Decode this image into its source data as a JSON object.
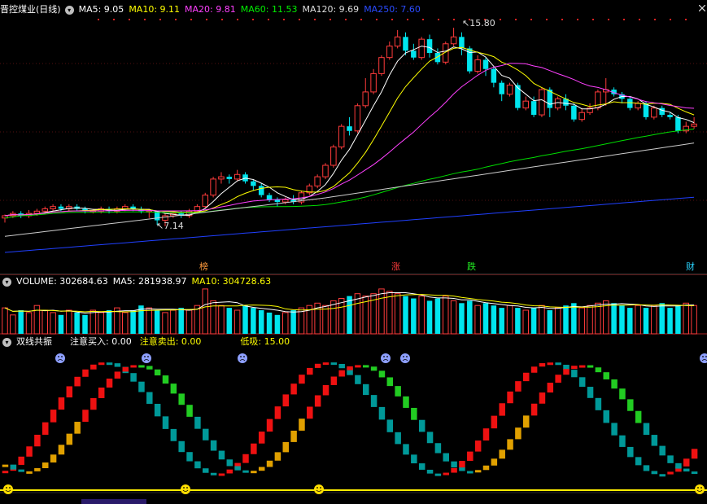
{
  "main_header": {
    "title": "晋控煤业(日线)",
    "ma5": "MA5: 9.05",
    "ma10": "MA10: 9.11",
    "ma20": "MA20: 9.81",
    "ma60": "MA60: 11.53",
    "ma120": "MA120: 9.69",
    "ma250": "MA250: 7.60"
  },
  "volume_header": {
    "volume": "VOLUME: 302684.63",
    "ma5": "MA5: 281938.97",
    "ma10": "MA10: 304728.63"
  },
  "indicator_header": {
    "name": "双线共振",
    "buy": "注意买入: 0.00",
    "sell": "注意卖出: 0.00",
    "low": "低吸: 15.00"
  },
  "annotations": {
    "high": "15.80",
    "low": "7.14"
  },
  "events": [
    "榜",
    "涨",
    "跌",
    "财"
  ],
  "colors": {
    "up": "#ff3b3b",
    "down": "#00e5ee",
    "ma5": "#ffffff",
    "ma10": "#ffff00",
    "ma20": "#ff40ff",
    "ma60": "#00dd00",
    "ma120": "#cccccc",
    "ma250": "#2040ff"
  },
  "chart_data": {
    "type": "candlestick",
    "price_range": [
      6.0,
      16.3
    ],
    "candles": [
      [
        7.5,
        7.6,
        7.3,
        7.65
      ],
      [
        7.6,
        7.7,
        7.5,
        7.8
      ],
      [
        7.7,
        7.6,
        7.5,
        7.8
      ],
      [
        7.6,
        7.7,
        7.5,
        7.85
      ],
      [
        7.7,
        7.8,
        7.6,
        7.9
      ],
      [
        7.8,
        7.9,
        7.7,
        8.0
      ],
      [
        7.9,
        8.0,
        7.8,
        8.1
      ],
      [
        8.0,
        7.9,
        7.8,
        8.1
      ],
      [
        7.9,
        8.0,
        7.8,
        8.1
      ],
      [
        8.0,
        7.9,
        7.8,
        8.1
      ],
      [
        7.9,
        7.8,
        7.7,
        8.0
      ],
      [
        7.8,
        7.8,
        7.7,
        7.9
      ],
      [
        7.8,
        7.9,
        7.7,
        8.0
      ],
      [
        7.9,
        7.8,
        7.7,
        8.0
      ],
      [
        7.8,
        7.9,
        7.7,
        8.0
      ],
      [
        7.9,
        8.0,
        7.8,
        8.1
      ],
      [
        8.0,
        7.9,
        7.8,
        8.1
      ],
      [
        7.9,
        7.8,
        7.7,
        8.0
      ],
      [
        7.8,
        7.8,
        7.5,
        7.9
      ],
      [
        7.8,
        7.4,
        7.2,
        7.8
      ],
      [
        7.4,
        7.6,
        7.14,
        7.7
      ],
      [
        7.6,
        7.7,
        7.5,
        7.8
      ],
      [
        7.7,
        7.6,
        7.5,
        7.8
      ],
      [
        7.6,
        7.8,
        7.5,
        7.9
      ],
      [
        7.8,
        8.0,
        7.7,
        8.1
      ],
      [
        8.0,
        8.5,
        7.9,
        8.6
      ],
      [
        8.5,
        9.2,
        8.4,
        9.3
      ],
      [
        9.2,
        9.3,
        9.0,
        9.5
      ],
      [
        9.3,
        9.2,
        9.0,
        9.4
      ],
      [
        9.2,
        9.4,
        9.1,
        9.6
      ],
      [
        9.4,
        9.1,
        9.0,
        9.5
      ],
      [
        9.1,
        8.9,
        8.7,
        9.2
      ],
      [
        8.9,
        8.5,
        8.4,
        9.0
      ],
      [
        8.5,
        8.3,
        8.2,
        8.6
      ],
      [
        8.3,
        8.2,
        8.0,
        8.4
      ],
      [
        8.2,
        8.3,
        8.1,
        8.4
      ],
      [
        8.3,
        8.2,
        8.1,
        8.5
      ],
      [
        8.2,
        8.6,
        8.1,
        8.7
      ],
      [
        8.6,
        8.9,
        8.5,
        9.0
      ],
      [
        8.9,
        9.3,
        8.8,
        9.4
      ],
      [
        9.3,
        9.8,
        9.2,
        9.9
      ],
      [
        9.8,
        10.6,
        9.7,
        10.7
      ],
      [
        10.6,
        11.5,
        10.5,
        11.6
      ],
      [
        11.5,
        11.3,
        11.1,
        11.9
      ],
      [
        11.3,
        12.4,
        11.2,
        12.5
      ],
      [
        12.4,
        13.0,
        12.3,
        13.6
      ],
      [
        13.0,
        13.8,
        12.9,
        14.0
      ],
      [
        13.8,
        14.5,
        13.7,
        14.6
      ],
      [
        14.5,
        15.0,
        14.4,
        15.2
      ],
      [
        15.0,
        15.4,
        14.9,
        15.7
      ],
      [
        15.4,
        14.8,
        14.6,
        15.6
      ],
      [
        14.8,
        14.5,
        14.4,
        15.1
      ],
      [
        14.5,
        15.3,
        14.4,
        15.4
      ],
      [
        15.3,
        14.7,
        14.5,
        15.5
      ],
      [
        14.7,
        14.3,
        14.2,
        14.9
      ],
      [
        14.3,
        15.1,
        14.2,
        15.2
      ],
      [
        15.1,
        15.4,
        15.0,
        15.8
      ],
      [
        15.4,
        14.9,
        14.6,
        15.6
      ],
      [
        14.9,
        13.9,
        13.8,
        15.0
      ],
      [
        13.9,
        14.4,
        13.8,
        14.6
      ],
      [
        14.4,
        14.0,
        13.7,
        14.5
      ],
      [
        14.0,
        13.4,
        13.2,
        14.1
      ],
      [
        13.4,
        12.9,
        12.6,
        13.5
      ],
      [
        12.9,
        13.3,
        12.8,
        13.4
      ],
      [
        13.3,
        12.3,
        12.2,
        13.4
      ],
      [
        12.3,
        12.6,
        12.2,
        12.8
      ],
      [
        12.6,
        12.0,
        11.9,
        12.8
      ],
      [
        12.0,
        13.1,
        11.9,
        13.2
      ],
      [
        13.1,
        12.3,
        11.9,
        13.2
      ],
      [
        12.3,
        12.7,
        12.2,
        12.8
      ],
      [
        12.7,
        12.4,
        12.2,
        12.9
      ],
      [
        12.4,
        11.8,
        11.7,
        12.5
      ],
      [
        11.8,
        12.1,
        11.7,
        12.3
      ],
      [
        12.1,
        12.3,
        12.0,
        12.5
      ],
      [
        12.3,
        13.0,
        12.2,
        13.1
      ],
      [
        13.0,
        13.1,
        12.4,
        13.6
      ],
      [
        13.1,
        12.9,
        12.8,
        13.2
      ],
      [
        12.9,
        12.7,
        12.5,
        13.0
      ],
      [
        12.7,
        12.3,
        12.2,
        12.8
      ],
      [
        12.3,
        12.5,
        12.2,
        12.6
      ],
      [
        12.5,
        11.9,
        11.8,
        12.6
      ],
      [
        11.9,
        12.3,
        11.8,
        12.4
      ],
      [
        12.3,
        12.0,
        11.9,
        12.4
      ],
      [
        12.0,
        11.9,
        11.8,
        12.1
      ],
      [
        11.9,
        11.3,
        11.2,
        12.0
      ],
      [
        11.3,
        11.5,
        11.2,
        11.7
      ],
      [
        11.5,
        11.6,
        11.4,
        11.9
      ]
    ],
    "volume_ratio": [
      0.55,
      0.4,
      0.5,
      0.45,
      0.6,
      0.5,
      0.45,
      0.4,
      0.5,
      0.45,
      0.4,
      0.5,
      0.45,
      0.5,
      0.55,
      0.45,
      0.5,
      0.6,
      0.55,
      0.5,
      0.45,
      0.5,
      0.55,
      0.5,
      0.6,
      0.95,
      0.7,
      0.6,
      0.55,
      0.5,
      0.6,
      0.55,
      0.5,
      0.45,
      0.4,
      0.45,
      0.5,
      0.55,
      0.6,
      0.65,
      0.6,
      0.7,
      0.75,
      0.8,
      0.85,
      0.8,
      0.85,
      0.95,
      0.9,
      0.85,
      0.8,
      0.75,
      0.8,
      0.7,
      0.75,
      0.8,
      0.7,
      0.65,
      0.7,
      0.6,
      0.65,
      0.6,
      0.55,
      0.6,
      0.55,
      0.5,
      0.55,
      0.6,
      0.5,
      0.55,
      0.6,
      0.65,
      0.55,
      0.6,
      0.65,
      0.7,
      0.65,
      0.6,
      0.55,
      0.6,
      0.55,
      0.6,
      0.65,
      0.55,
      0.6,
      0.65,
      0.6
    ]
  }
}
